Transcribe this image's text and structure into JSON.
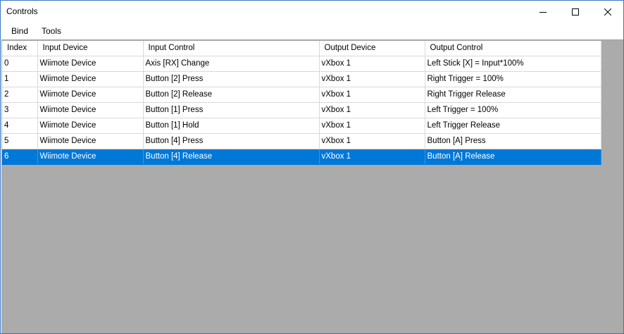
{
  "window": {
    "title": "Controls"
  },
  "menu": {
    "items": [
      {
        "label": "Bind"
      },
      {
        "label": "Tools"
      }
    ]
  },
  "grid": {
    "columns": [
      "Index",
      "Input Device",
      "Input Control",
      "Output Device",
      "Output Control"
    ],
    "rows": [
      {
        "index": "0",
        "input_device": "Wiimote Device",
        "input_control": "Axis [RX] Change",
        "output_device": "vXbox 1",
        "output_control": "Left Stick [X] = Input*100%"
      },
      {
        "index": "1",
        "input_device": "Wiimote Device",
        "input_control": "Button [2] Press",
        "output_device": "vXbox 1",
        "output_control": "Right Trigger = 100%"
      },
      {
        "index": "2",
        "input_device": "Wiimote Device",
        "input_control": "Button [2] Release",
        "output_device": "vXbox 1",
        "output_control": "Right Trigger Release"
      },
      {
        "index": "3",
        "input_device": "Wiimote Device",
        "input_control": "Button [1] Press",
        "output_device": "vXbox 1",
        "output_control": "Left Trigger = 100%"
      },
      {
        "index": "4",
        "input_device": "Wiimote Device",
        "input_control": "Button [1] Hold",
        "output_device": "vXbox 1",
        "output_control": "Left Trigger Release"
      },
      {
        "index": "5",
        "input_device": "Wiimote Device",
        "input_control": "Button [4] Press",
        "output_device": "vXbox 1",
        "output_control": "Button [A] Press"
      },
      {
        "index": "6",
        "input_device": "Wiimote Device",
        "input_control": "Button [4] Release",
        "output_device": "vXbox 1",
        "output_control": "Button [A] Release"
      }
    ],
    "selected_row": 6
  },
  "colors": {
    "selection": "#0078d7",
    "empty_area": "#ababab",
    "window_border": "#3b78c4"
  },
  "icons": {
    "minimize": "minimize-icon",
    "maximize": "maximize-icon",
    "close": "close-icon"
  }
}
